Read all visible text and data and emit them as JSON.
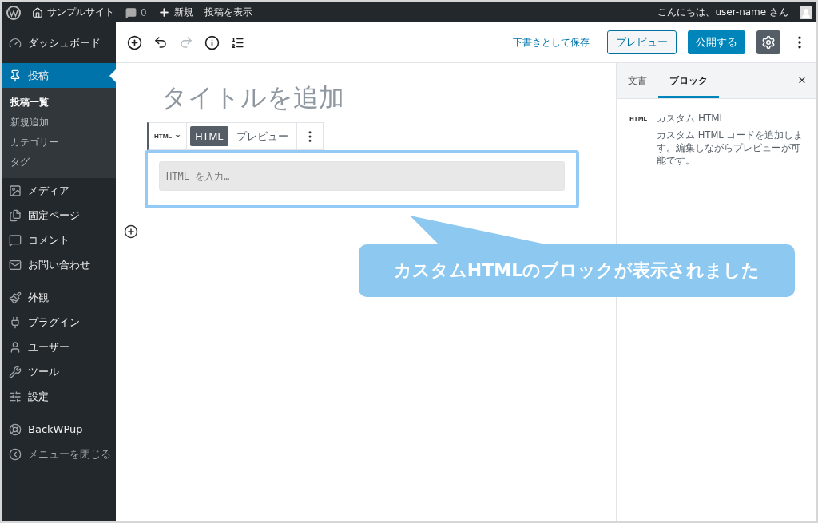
{
  "admin_bar": {
    "site_name": "サンプルサイト",
    "comments": "0",
    "new": "新規",
    "view_post": "投稿を表示",
    "greeting": "こんにちは、user-name さん"
  },
  "sidebar": {
    "groups": [
      [
        {
          "label": "ダッシュボード",
          "selected": false
        }
      ],
      [
        {
          "label": "投稿",
          "selected": true,
          "children": [
            {
              "label": "投稿一覧",
              "selected": true
            },
            {
              "label": "新規追加",
              "selected": false
            },
            {
              "label": "カテゴリー",
              "selected": false
            },
            {
              "label": "タグ",
              "selected": false
            }
          ]
        },
        {
          "label": "メディア",
          "selected": false
        },
        {
          "label": "固定ページ",
          "selected": false
        },
        {
          "label": "コメント",
          "selected": false
        },
        {
          "label": "お問い合わせ",
          "selected": false
        }
      ],
      [
        {
          "label": "外観",
          "selected": false
        },
        {
          "label": "プラグイン",
          "selected": false
        },
        {
          "label": "ユーザー",
          "selected": false
        },
        {
          "label": "ツール",
          "selected": false
        },
        {
          "label": "設定",
          "selected": false
        }
      ],
      [
        {
          "label": "BackWPup",
          "selected": false,
          "kind": "item"
        },
        {
          "label": "メニューを閉じる",
          "selected": false,
          "kind": "collapse"
        }
      ]
    ]
  },
  "editor_toolbar": {
    "redo_disabled": true,
    "save_draft": "下書きとして保存",
    "preview": "プレビュー",
    "publish": "公開する",
    "settings_selected": true
  },
  "post": {
    "title_placeholder": "タイトルを追加"
  },
  "block": {
    "type_label": "HTML",
    "tabs": [
      {
        "label": "HTML",
        "selected": true
      },
      {
        "label": "プレビュー",
        "selected": false
      }
    ],
    "placeholder": "HTML を入力…"
  },
  "settings_panel": {
    "tabs": [
      {
        "label": "文書",
        "selected": false
      },
      {
        "label": "ブロック",
        "selected": true
      }
    ],
    "close": "×",
    "block_icon_label": "HTML",
    "block_title": "カスタム HTML",
    "block_description": "カスタム HTML コードを追加します。編集しながらプレビューが可能です。"
  },
  "callout": {
    "text": "カスタムHTMLのブロックが表示されました"
  }
}
